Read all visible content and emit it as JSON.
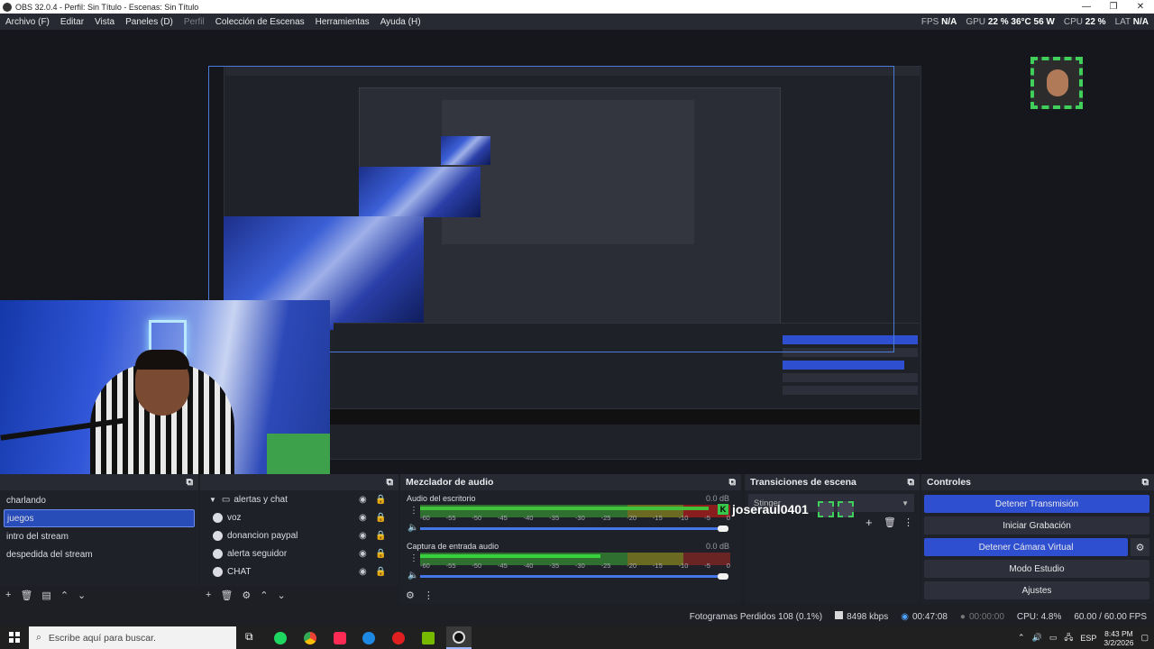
{
  "window": {
    "title": "OBS 32.0.4 - Perfil: Sin Título - Escenas: Sin Título"
  },
  "menu": [
    "Archivo (F)",
    "Editar",
    "Vista",
    "Paneles (D)",
    "Perfil",
    "Colección de Escenas",
    "Herramientas",
    "Ayuda (H)"
  ],
  "stats": {
    "fps_label": "FPS",
    "fps": "N/A",
    "gpu_label": "GPU",
    "gpu": "22 %  36°C  56 W",
    "cpu_label": "CPU",
    "cpu": "22 %",
    "lat_label": "LAT",
    "lat": "N/A"
  },
  "scenes": {
    "items": [
      "charlando",
      "juegos",
      "intro del stream",
      "despedida del stream"
    ],
    "selected": "juegos"
  },
  "sources": {
    "items": [
      "alertas y chat",
      "voz",
      "donancion paypal",
      "alerta seguidor",
      "CHAT"
    ]
  },
  "mixer": {
    "title": "Mezclador de audio",
    "channels": [
      {
        "name": "Audio del escritorio",
        "db": "0.0 dB"
      },
      {
        "name": "Captura de entrada audio",
        "db": "0.0 dB"
      }
    ],
    "ticks": [
      "-60",
      "-55",
      "-50",
      "-45",
      "-40",
      "-35",
      "-30",
      "-25",
      "-20",
      "-15",
      "-10",
      "-5",
      "0"
    ]
  },
  "transitions": {
    "title": "Transiciones de escena",
    "selected": "Stinger"
  },
  "overlay_user": "joseraul0401",
  "controls": {
    "title": "Controles",
    "stop_stream": "Detener Transmisión",
    "start_rec": "Iniciar Grabación",
    "stop_vcam": "Detener Cámara Virtual",
    "studio": "Modo Estudio",
    "settings": "Ajustes"
  },
  "status": {
    "dropped": "Fotogramas Perdidos 108 (0.1%)",
    "bitrate": "8498 kbps",
    "stream_time": "00:47:08",
    "rec_time": "00:00:00",
    "cpu": "CPU: 4.8%",
    "fps": "60.00 / 60.00 FPS"
  },
  "taskbar": {
    "search_placeholder": "Escribe aquí para buscar.",
    "lang": "ESP",
    "time": "8:43 PM",
    "date": "3/2/2026"
  },
  "colors": {
    "accent": "#2e4fd0",
    "bg": "#1e1f25",
    "panel": "#272a33"
  }
}
